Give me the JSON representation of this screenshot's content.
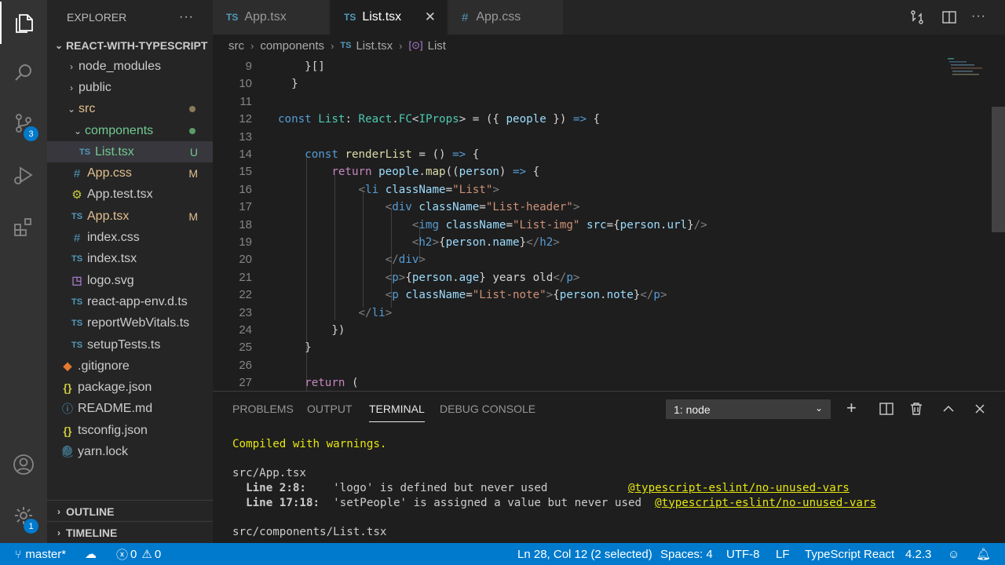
{
  "activity": {
    "scm_badge": "3",
    "settings_badge": "1"
  },
  "sidebar": {
    "title": "EXPLORER",
    "more": "···",
    "project": "REACT-WITH-TYPESCRIPT",
    "items": [
      {
        "label": "node_modules",
        "icon": "chevron-right",
        "status": ""
      },
      {
        "label": "public",
        "icon": "chevron-right",
        "status": ""
      },
      {
        "label": "src",
        "icon": "chevron-down",
        "status": "dot"
      },
      {
        "label": "components",
        "icon": "chevron-down",
        "status": "dot"
      },
      {
        "label": "List.tsx",
        "icon": "ts",
        "status": "U"
      },
      {
        "label": "App.css",
        "icon": "css",
        "status": "M"
      },
      {
        "label": "App.test.tsx",
        "icon": "gear",
        "status": ""
      },
      {
        "label": "App.tsx",
        "icon": "ts",
        "status": "M"
      },
      {
        "label": "index.css",
        "icon": "css",
        "status": ""
      },
      {
        "label": "index.tsx",
        "icon": "ts",
        "status": ""
      },
      {
        "label": "logo.svg",
        "icon": "svg",
        "status": ""
      },
      {
        "label": "react-app-env.d.ts",
        "icon": "ts",
        "status": ""
      },
      {
        "label": "reportWebVitals.ts",
        "icon": "ts",
        "status": ""
      },
      {
        "label": "setupTests.ts",
        "icon": "ts",
        "status": ""
      },
      {
        "label": ".gitignore",
        "icon": "git",
        "status": ""
      },
      {
        "label": "package.json",
        "icon": "json",
        "status": ""
      },
      {
        "label": "README.md",
        "icon": "info",
        "status": ""
      },
      {
        "label": "tsconfig.json",
        "icon": "json",
        "status": ""
      },
      {
        "label": "yarn.lock",
        "icon": "yarn",
        "status": ""
      }
    ],
    "outline": "OUTLINE",
    "timeline": "TIMELINE"
  },
  "tabs": [
    {
      "label": "App.tsx",
      "icon": "TS"
    },
    {
      "label": "List.tsx",
      "icon": "TS",
      "close": "✕"
    },
    {
      "label": "App.css",
      "icon": "#"
    }
  ],
  "breadcrumb": {
    "a": "src",
    "b": "components",
    "c": "List.tsx",
    "c_icon": "TS",
    "d": "List"
  },
  "editor": {
    "line_numbers": [
      "9",
      "10",
      "11",
      "12",
      "13",
      "14",
      "15",
      "16",
      "17",
      "18",
      "19",
      "20",
      "21",
      "22",
      "23",
      "24",
      "25",
      "26",
      "27"
    ]
  },
  "panel": {
    "tabs": [
      "PROBLEMS",
      "OUTPUT",
      "TERMINAL",
      "DEBUG CONSOLE"
    ],
    "terminal_select": "1: node",
    "lines": {
      "compiled": "Compiled with warnings.",
      "file1": "src/App.tsx",
      "l1_loc": "  Line 2:8:",
      "l1_msg": "    'logo' is defined but never used",
      "l1_rule": "@typescript-eslint/no-unused-vars",
      "l2_loc": "  Line 17:18:",
      "l2_msg": "  'setPeople' is assigned a value but never used",
      "l2_rule": "@typescript-eslint/no-unused-vars",
      "file2": "src/components/List.tsx"
    }
  },
  "status": {
    "branch": "master*",
    "errors": "0",
    "warnings": "0",
    "position": "Ln 28, Col 12 (2 selected)",
    "spaces": "Spaces: 4",
    "encoding": "UTF-8",
    "eol": "LF",
    "language": "TypeScript React",
    "version": "4.2.3"
  }
}
